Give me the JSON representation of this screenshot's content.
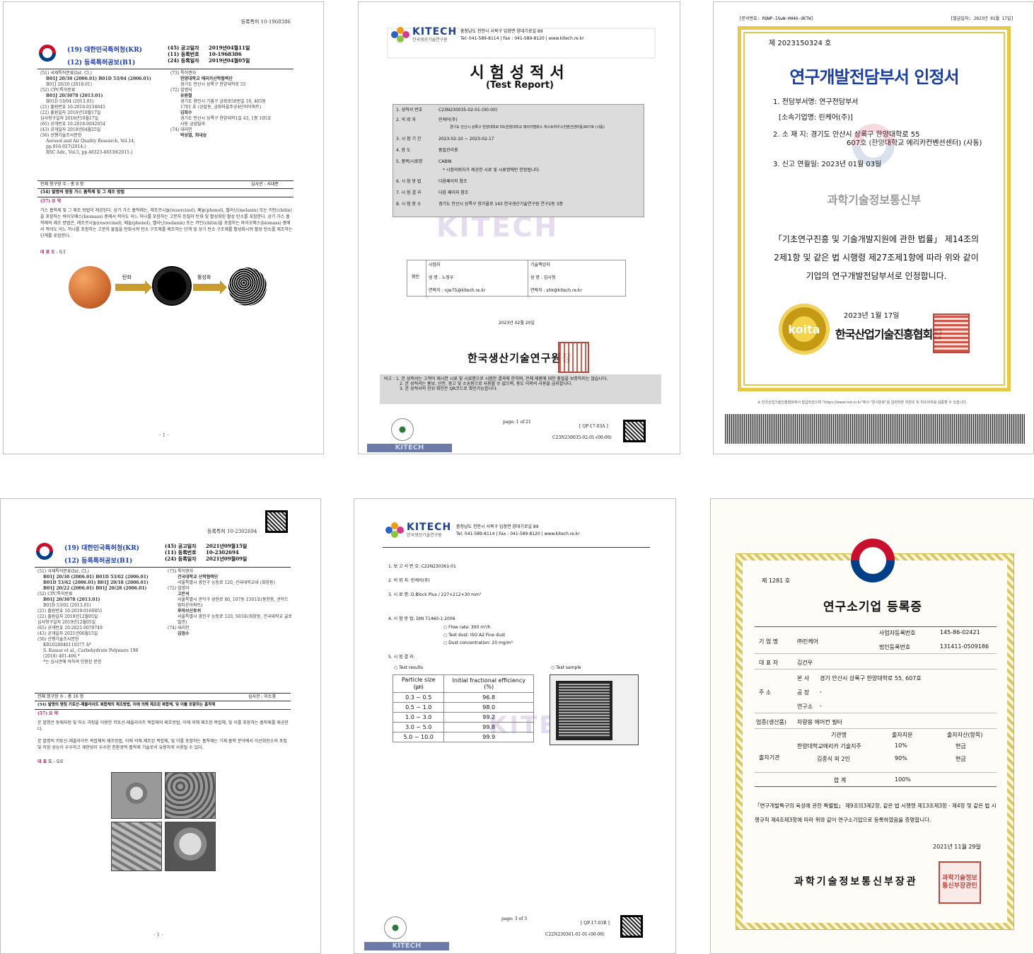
{
  "doc1": {
    "top_num": "등록특허 10-1968386",
    "office": "(19) 대한민국특허청(KR)",
    "pub_type": "(12) 등록특허공보(B1)",
    "meta": [
      {
        "k": "(45) 공고일자",
        "v": "2019년04월11일"
      },
      {
        "k": "(11) 등록번호",
        "v": "10-1968386"
      },
      {
        "k": "(24) 등록일자",
        "v": "2019년04월05일"
      }
    ],
    "left_lines": [
      "(51) 국제특허분류(Int. Cl.)",
      "B01J 20/30 (2006.01)  B01D 53/04 (2006.01)",
      "B01J 20/20 (2018.01)",
      "(52) CPC특허분류",
      "B01J 20/3078 (2013.01)",
      "B01D 53/04 (2013.01)",
      "(21) 출원번호      10-2016-0134645",
      "(22) 출원일자      2016년10월17일",
      "     심사청구일자   2016년10월17일",
      "(65) 공개번호      10-2018-0042054",
      "(43) 공개일자      2018년04월25일",
      "(56) 선행기술조사문헌",
      "Aerosol and Air Quality Research, Vol.14,",
      "pp.916-927(2014.)",
      "RSC Adv., Vol.5, pp.48323-48330(2015.)"
    ],
    "right_lines": [
      "(73) 특허권자",
      "한양대학교 에리카산학협력단",
      "경기도 안산시 상록구 한양대학로 55",
      "(72) 발명자",
      "유원철",
      "경기도 용인시 기흥구 금화로58번길 10, 405동",
      "1701 호 (상갈동, 금화마을주공4단지아파트)",
      "김희수",
      "경기도 안산시 상록구 한양대학1길 43, 1층 105호",
      "사동 금성빌라",
      "(74) 대리인",
      "박상열, 최내승"
    ],
    "claims": "전체 청구항 수 : 총 8 항",
    "examiner": "심사관 :   서대준",
    "title": "(54) 발명의 명칭 가스 흡착제 및 그 제조 방법",
    "abstract_h": "(57) 요 약",
    "abstract": "가스 흡착제 및 그 제조 방법이 제공된다. 상기 가스 흡착제는, 레조르시놀(resorcinol), 페놀(phenol), 멜라닌(melanin) 또는 키틴(chitin)을 포함하는 바이오매스(biomass) 중에서 적어도 어느 하나를 포함하는 고분자 등질이 탄화 및 활성화된 활성 탄소를 포함한다. 상기 가스 흡착제의 제조 방법은, 레조르시놀(resorcinol), 페놀(phenol), 멜라닌(melanin) 또는 키틴(chitin)을 포함하는 바이오매스(biomass) 중에서 적어도 어느 하나를 포함하는 고분자 물질을 탄화시켜 탄소 구조체를 제조하는 단계 및 상기 탄소 구조체를 활성화시켜 활성 탄소를 제조하는 단계를 포함한다.",
    "rep_h": "대 표 도",
    "rep_v": "- 도1",
    "arrow1": "탄화",
    "arrow2": "활성화",
    "footer": "- 1 -"
  },
  "doc2": {
    "kitech": "KITECH",
    "kitech_sub": "한국생산기술연구원",
    "addr": "충청남도 천안시 서북구 입장면 양대기로길 89",
    "tel": "Tel: 041-589-8114  |  Fax : 041-589-8120  |  www.kitech.re.kr",
    "title": "시험성적서",
    "subtitle": "(Test Report)",
    "rows": [
      {
        "k": "1. 성적서 번호",
        "v": "C23N230035-02-01-(00-00)"
      },
      {
        "k": "2. 의 뢰 자",
        "v": "린케어(주)"
      },
      {
        "k": "",
        "v": "경기도 안산시 상록구 한양대학로 55(한양대학교 에리카캠퍼스 게스트하우스컨벤션센터동)607호 (사동)"
      },
      {
        "k": "3. 시 험 기 간",
        "v": "2023-02-10 ~ 2023-02-17"
      },
      {
        "k": "4. 용    도",
        "v": "품질관리용"
      },
      {
        "k": "5. 품목/시료명",
        "v": "CABIN"
      },
      {
        "k": "",
        "v": "* 시험의뢰자가 제공한 시료 및 시료명에만 한정됩니다."
      },
      {
        "k": "6. 시 험 방 법",
        "v": "다음페이지 참조"
      },
      {
        "k": "7. 시 험 결 과",
        "v": "다음 페이지 참조"
      },
      {
        "k": "8. 시 험 장 소",
        "v": "경기도 안산시 상록구 항가울로 143 한국생산기술연구원 연구2동 3층"
      }
    ],
    "confirm": "확인",
    "tester_h": "시험자",
    "tester_name": "성  명 : 노정우",
    "tester_contact": "연락처 : njw75@kitech.re.kr",
    "tech_h": "기술책임자",
    "tech_name": "성  명 : 김시형",
    "tech_contact": "연락처 : shk@kitech.re.kr",
    "date": "2023년 02월 20일",
    "issuer": "한국생산기술연구원장",
    "notes": [
      "비고 : 1. 본 성적서는 고객이 제시한 시료 및 시료명으로 시험한 결과에 한하며, 전체 제품에 대한 품질을 보증하지는 않습니다.",
      "2. 본 성적서는 홍보, 선전, 광고 및 소송용으로 사용할 수 없으며, 용도 이외의 사용을 금지합니다.",
      "3. 본 성적서의 진위 확인은 QR코드로 확인가능합니다."
    ],
    "page": "page: 1 of 21",
    "qp": "[ QP-17-03A ]",
    "code": "C23N230035-02-01-(00-00)",
    "watermark": "KITECH"
  },
  "doc3": {
    "top_left": "[문서번호: RQWP-IGwW-HH4O-dKTW]",
    "top_right": "[발급일자: 2023년 01월 17일]",
    "no": "제 2023150324 호",
    "title": "연구개발전담부서 인정서",
    "l1": "1. 전담부서명:  연구전담부서",
    "l1b": "[소속기업명: 린케어(주)]",
    "l2": "2. 소  재  지:  경기도 안산시 상록구 한양대학로 55",
    "l2b": "607호 (한양대학교 에리카컨벤션센터) (사동)",
    "l3": "3. 신고 연월일:  2023년 01월 03일",
    "ministry": "과학기술정보통신부",
    "body": "「기초연구진흥 및 기술개발지원에 관한 법률」 제14조의 2제1항 및 같은 법 시행령 제27조제1항에 따라 위와 같이 기업의 연구개발전담부서로 인정합니다.",
    "date": "2023년 1월 17일",
    "issuer": "한국산업기술진흥협회장",
    "seal_text": "koita",
    "foot": "※ 한국산업기술진흥협회에서 발급되었으며 \"https://www.rnd.or.kr\"에서 \"문서번호\"를 입력하면 위변조 및 위조여부를 검증할 수 있습니다."
  },
  "doc4": {
    "top_num": "등록특허 10-2302694",
    "office": "(19) 대한민국특허청(KR)",
    "pub_type": "(12) 등록특허공보(B1)",
    "meta": [
      {
        "k": "(45) 공고일자",
        "v": "2021년09월15일"
      },
      {
        "k": "(11) 등록번호",
        "v": "10-2302694"
      },
      {
        "k": "(24) 등록일자",
        "v": "2021년09월09일"
      }
    ],
    "left_lines": [
      "(51) 국제특허분류(Int. Cl.)",
      "B01J 20/30 (2006.01)  B01D 53/02 (2006.01)",
      "B01D 53/62 (2006.01)  B01J 20/18 (2006.01)",
      "B01J 20/22 (2006.01)  B01J 20/28 (2006.01)",
      "(52) CPC특허분류",
      "B01J 20/3078 (2013.01)",
      "B01D 53/02 (2013.01)",
      "(21) 출원번호      10-2019-0160851",
      "(22) 출원일자      2019년12월05일",
      "     심사청구일자   2019년12월05일",
      "(65) 공개번호      10-2021-0070749",
      "(43) 공개일자      2021년06월15일",
      "(56) 선행기술조사문헌",
      "KR1020040110377 A*",
      "S. Kumar et al., Carbohydrate Polymers 198",
      "(2018) 401-406.*",
      "*는 심사관에 의하여 인용된 문헌"
    ],
    "right_lines": [
      "(73) 특허권자",
      "건국대학교 산학협력단",
      "서울특별시 광진구 능동로 120, 건국대학교내 (화양동)",
      "(72) 발명자",
      "고은석",
      "서울특별시 관악구 성현로 80, 107동 1501호(봉천동, 관악드림타운아파트)",
      "루마브산토쉬",
      "서울특별시 광진구 능동로 120, 503호(화양동, 건국대학교 글로벌관)",
      "(74) 대리인",
      "김정수"
    ],
    "claims": "전체 청구항 수 : 총 16 항",
    "examiner": "심사관 :   이소영",
    "title": "(54) 발명의 명칭 키토산-제올라이트 복합체의 제조방법, 이에 의해 제조된 복합체, 및 이를 포함하는 흡착제",
    "abstract_h": "(57) 요 약",
    "abstract1": "본 발명은 동애지렁 및 하소 과정을 이용한 키토산-제올라이트 복합체의 제조방법, 이에 의해 제조된 복합체, 및 이를 포함하는 흡착제를 제공한다.",
    "abstract2": "본 발명의 키토산-제올라이트 복합체의 제조방법, 이에 의해 제조된 복합체, 및 이를 포함하는 흡착제는 기체 흡착 분야에서 이산화탄소의 포집 및 저장 성능이 우수하고 재현성이 우수한 친환경적 흡착제 기술로서 유용하게 사용될 수 있다.",
    "rep_h": "대 표 도",
    "rep_v": "- 도6",
    "footer": "- 1 -"
  },
  "doc5": {
    "kitech": "KITECH",
    "kitech_sub": "한국생산기술연구원",
    "addr": "충청남도 천안시 서북구 입장면 양대기로길 89",
    "tel": "Tel: 041-589-8114  |  Fax : 041-589-8120  |  www.kitech.re.kr",
    "l1": "1. 보 고 서   번 호:  C22N230361-01",
    "l2": "2. 의      뢰      자:  린케어(주)",
    "l3": "3. 시          료   명:  D.Block Plus / 227×212×30 mm³",
    "l4": "4. 시   험   방   법:  DIN 71460-1:2006",
    "l4a": "○ Flow rate: 300 m³/h",
    "l4b": "○ Test dust: ISO A2 Fine dust",
    "l4c": "○ Dust concentration: 20 mg/m³",
    "l5": "5. 시   험   결   과:",
    "results_h": "○ Test results",
    "sample_h": "○ Test sample",
    "col1": "Particle size (㎛)",
    "col2": "Initial fractional efficiency (%)",
    "table": [
      {
        "size": "0.3  ~  0.5",
        "eff": "96.8"
      },
      {
        "size": "0.5  ~  1.0",
        "eff": "98.0"
      },
      {
        "size": "1.0  ~  3.0",
        "eff": "99.2"
      },
      {
        "size": "3.0  ~  5.0",
        "eff": "99.8"
      },
      {
        "size": "5.0  ~  10.0",
        "eff": "99.9"
      }
    ],
    "page": "page: 3 of 3",
    "qp": "[ QP-17-03B ]",
    "code": "C22N230361-01-01-(00-00)",
    "watermark": "KITECH"
  },
  "doc6": {
    "no": "제 1281 호",
    "title": "연구소기업 등록증",
    "rows": {
      "company_k": "기 업 명",
      "company_v": "㈜린케어",
      "bizno_k": "사업자등록번호",
      "bizno_v": "145-86-02421",
      "corpno_k": "법인등록번호",
      "corpno_v": "131411-0509186",
      "ceo_k": "대 표 자",
      "ceo_v": "김건우",
      "addr_k": "주    소",
      "hq_k": "본  사",
      "hq_v": "경기 안산시 상록구 한양대학로 55, 607호",
      "factory_k": "공  장",
      "factory_v": "-",
      "lab_k": "연구소",
      "lab_v": "-",
      "biz_k": "업종(생산품)",
      "biz_v": "차량용 에어컨 필터",
      "inv_k": "출자기관",
      "inv_h1": "기관명",
      "inv_h2": "출자지분",
      "inv_h3": "출자자산(항목)",
      "inv": [
        {
          "name": "한양대학교에리카 기술지주",
          "share": "10%",
          "asset": "현금"
        },
        {
          "name": "김종식 외 2인",
          "share": "90%",
          "asset": "현금"
        }
      ],
      "total_k": "합  계",
      "total_v": "100%"
    },
    "body": "「연구개발특구의 육성에 관한 특별법」 제9조의3제2항, 같은 법 시행령 제13조제3항ㆍ제4항 및 같은 법 시행규칙 제4조제3항에 따라 위와 같이 연구소기업으로 등록하였음을 증명합니다.",
    "date": "2021년    11월    29일",
    "issuer": "과학기술정보통신부장관",
    "seal": "과학기술정보통신부장관인"
  }
}
